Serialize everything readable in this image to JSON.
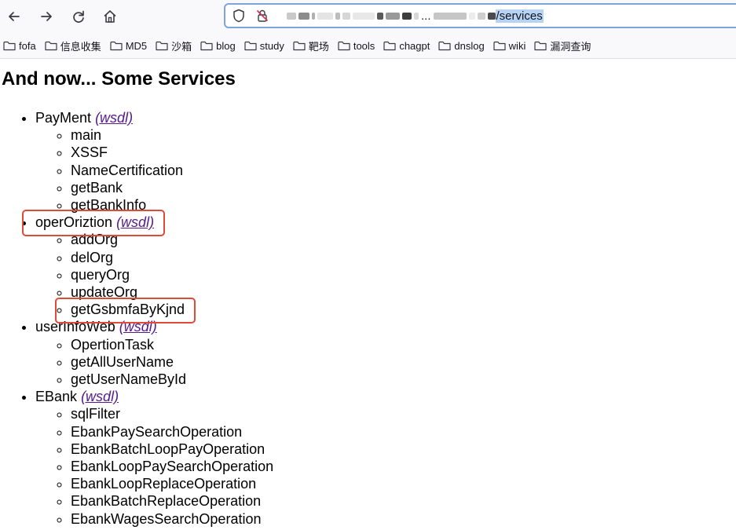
{
  "browser": {
    "url_path": "/services",
    "url_fragment": "..."
  },
  "bookmarks": [
    "fofa",
    "信息收集",
    "MD5",
    "沙箱",
    "blog",
    "study",
    "靶场",
    "tools",
    "chagpt",
    "dnslog",
    "wiki",
    "漏洞查询"
  ],
  "page": {
    "heading": "And now... Some Services",
    "wsdl_label": "(wsdl)",
    "services": [
      {
        "name": "PayMent",
        "operations": [
          "main",
          "XSSF",
          "NameCertification",
          "getBank",
          "getBankInfo"
        ]
      },
      {
        "name": "operOriztion",
        "operations": [
          "addOrg",
          "delOrg",
          "queryOrg",
          "updateOrg",
          "getGsbmfaByKjnd"
        ]
      },
      {
        "name": "userInfoWeb",
        "operations": [
          "OpertionTask",
          "getAllUserName",
          "getUserNameById"
        ]
      },
      {
        "name": "EBank",
        "operations": [
          "sqlFilter",
          "EbankPaySearchOperation",
          "EbankBatchLoopPayOperation",
          "EbankLoopPaySearchOperation",
          "EbankLoopReplaceOperation",
          "EbankBatchReplaceOperation",
          "EbankWagesSearchOperation"
        ]
      }
    ]
  }
}
